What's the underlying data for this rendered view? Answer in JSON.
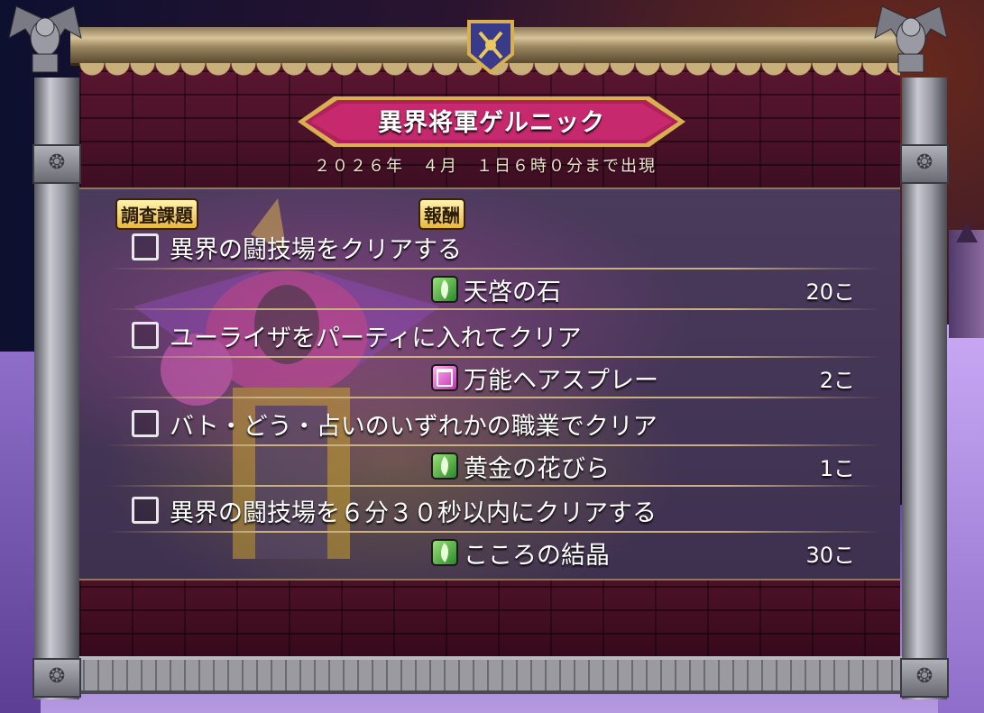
{
  "quest": {
    "title": "異界将軍ゲルニック",
    "deadline": "２０２６年　４月　１日６時０分まで出現",
    "header_tasks": "調査課題",
    "header_rewards": "報酬"
  },
  "tasks": [
    {
      "label": "異界の闘技場をクリアする",
      "checked": false,
      "reward": {
        "icon": "leaf-icon",
        "name": "天啓の石",
        "count": "20こ"
      }
    },
    {
      "label": "ユーライザをパーティに入れてクリア",
      "checked": false,
      "reward": {
        "icon": "hair-spray-icon",
        "name": "万能ヘアスプレー",
        "count": "2こ"
      }
    },
    {
      "label": "バト・どう・占いのいずれかの職業でクリア",
      "checked": false,
      "reward": {
        "icon": "leaf-icon",
        "name": "黄金の花びら",
        "count": "1こ"
      }
    },
    {
      "label": "異界の闘技場を６分３０秒以内にクリアする",
      "checked": false,
      "reward": {
        "icon": "leaf-icon",
        "name": "こころの結晶",
        "count": "30こ"
      }
    }
  ],
  "colors": {
    "brick": "#4e1228",
    "panel": "#3e3150",
    "banner": "#b0205a",
    "header_gold": "#e8b840"
  }
}
